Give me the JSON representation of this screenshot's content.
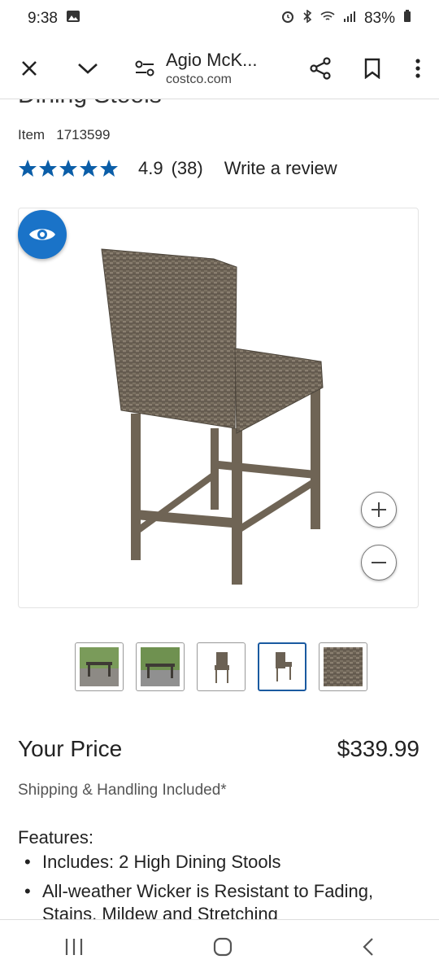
{
  "status": {
    "time": "9:38",
    "battery": "83%"
  },
  "toolbar": {
    "title": "Agio McK...",
    "url": "costco.com"
  },
  "product": {
    "cut_title": "Dining Stools",
    "item_label": "Item",
    "item_number": "1713599",
    "rating_value": "4.9",
    "rating_count": "(38)",
    "rating_stars": 5,
    "write_review": "Write a review"
  },
  "price": {
    "label": "Your Price",
    "amount": "$339.99",
    "shipping": "Shipping & Handling Included*"
  },
  "features": {
    "heading": "Features:",
    "items": [
      "Includes: 2 High Dining Stools",
      "All-weather Wicker is Resistant to Fading,",
      "Stains, Mildew and Stretching"
    ]
  },
  "thumbnails": [
    "scene-thumb",
    "scene-thumb",
    "stool-thumb",
    "stool-thumb",
    "wicker-thumb"
  ],
  "selected_thumbnail": 4,
  "colors": {
    "star": "#0b5ea8",
    "accent": "#1a73c8"
  }
}
